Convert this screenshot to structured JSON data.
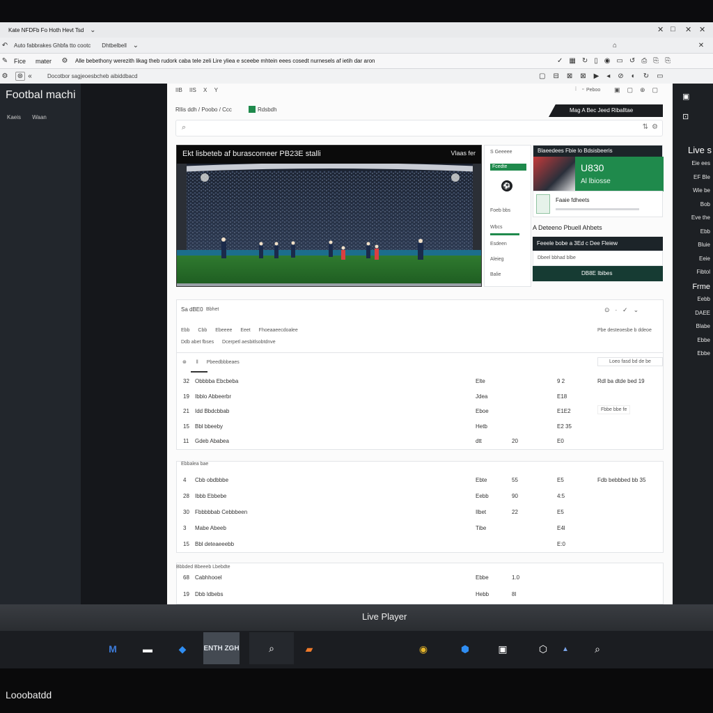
{
  "browser": {
    "tab_title": "Kate NFDFb Fo Hoth Hevt Tsd",
    "row2_tab1": "Auto fabbrakes Ghbfa tto cootc",
    "row2_tab2": "Dhtbelbell",
    "addr_label1": "Fice",
    "addr_label2": "mater",
    "address": "Alle bebethony werezith likag theb rudork caba tele zeli Lire yliea e sceebe mhtein eees cosedt nurnesels af ietih dar aron",
    "bookmark": "Docotbor sagjeoesbcheb aibiddbacd",
    "window_btns": [
      "✕",
      "□",
      "✕",
      "✕"
    ]
  },
  "left": {
    "title": "Footbal machi",
    "sub1": "Kaeis",
    "sub2": "Waan"
  },
  "main": {
    "toolbar": [
      "IIB",
      "IIS",
      "X",
      "Y"
    ],
    "toolbar_right": "Peboo",
    "breadcrumb": "Rllis ddh / Poobo / Ccc",
    "breadcrumb_tag": "Rdsbdh",
    "promo": "Mag A Bec Jeed Riballtae",
    "video_title": "Ekt lisbeteb af burascomeer PB23E stalli",
    "video_tag": "Vlaas fer",
    "side_title": "S Geeeee",
    "side_badge": "Fcedte",
    "side_l1": "Foeb bbs",
    "side_l2": "Wbcs",
    "side_l3": "Esdeen",
    "side_l4": "Aleieg",
    "side_l5": "Balie",
    "card_header": "Blaeedees Fbie lo Bdsisbeeris",
    "score": "U830",
    "score_sub": "Al lbiosse",
    "news1": "Faaie fdheets",
    "news2": "A Deteeno Pbuell Ahbets",
    "dark_card": "Feeele bobe a 3Ed c Dee Fleiew",
    "dark_card_sub": "Dbeel bbhad blbe",
    "dark_btn": "DB8E Ibibes"
  },
  "stats": {
    "header": "Sa dBE0",
    "header_sub": "Bbhet",
    "tabs": [
      "Ebb",
      "Cbb",
      "Ebeeee",
      "Eeet",
      "Fhoeaaeecdoalee"
    ],
    "sub_tabs": [
      "Ddb abet fbses",
      "Dcerpetl aesbitlsobtdnve"
    ],
    "filter": "Pbeedbbbeaes",
    "filter_right": "Loeo fasd bd de be",
    "side_note1": "Pbe desteoesbe b ddeoe",
    "side_note2": "Fbbe bbe fe",
    "rows1": [
      {
        "n": "32",
        "name": "Obbbba Ebcbeba",
        "pos": "Elte",
        "a": "",
        "b": "9 2",
        "side": "Rdl ba dtde bed 19"
      },
      {
        "n": "19",
        "name": "Ibblo Abbeerbr",
        "pos": "Jdea",
        "a": "",
        "b": "E18",
        "side": ""
      },
      {
        "n": "21",
        "name": "Idd Bbdcbbab",
        "pos": "Eboe",
        "a": "",
        "b": "E1E2",
        "side": ""
      },
      {
        "n": "15",
        "name": "Bbl bbeeby",
        "pos": "Hetb",
        "a": "",
        "b": "E2 35",
        "side": ""
      },
      {
        "n": "11",
        "name": "Gdeb Ababea",
        "pos": "dtt",
        "a": "20",
        "b": "E0",
        "side": ""
      }
    ],
    "group2": "Ebbalea bae",
    "rows2": [
      {
        "n": "4",
        "name": "Cbb obdbbbe",
        "pos": "Ebte",
        "a": "55",
        "b": "E5",
        "side": "Fdb bebbbed bb 35"
      },
      {
        "n": "28",
        "name": "Ibbb Ebbebe",
        "pos": "Eebb",
        "a": "90",
        "b": "4:5",
        "side": ""
      },
      {
        "n": "30",
        "name": "Fbbbbbab Cebbbeen",
        "pos": "Ilbet",
        "a": "22",
        "b": "E5",
        "side": ""
      },
      {
        "n": "3",
        "name": "Mabe Abeeb",
        "pos": "Tibe",
        "a": "",
        "b": "E4l",
        "side": ""
      },
      {
        "n": "15",
        "name": "Bbl deteaeeebb",
        "pos": "",
        "a": "",
        "b": "E:0",
        "side": ""
      }
    ],
    "group3": "Bbbded Bbeeeb Lbebdte",
    "rows3": [
      {
        "n": "68",
        "name": "Cabhhooel",
        "pos": "Ebbe",
        "a": "1.0"
      },
      {
        "n": "19",
        "name": "Dbb ldbebs",
        "pos": "Hebb",
        "a": "8l"
      }
    ]
  },
  "right": {
    "title": "Live s",
    "items": [
      "Eie ees",
      "EF Ble",
      "Wie be",
      "Bob",
      "Eve the",
      "Ebb",
      "Bluie",
      "Eeie",
      "Fibtol",
      "Frme",
      "Eebb",
      "DAEE",
      "Blabe",
      "Ebbe",
      "Ebbe"
    ]
  },
  "player": {
    "label": "Live Player"
  },
  "taskbar": {
    "icons": [
      "M",
      "folder",
      "shield",
      "ENTH ZGH",
      "search",
      "office",
      "chrome",
      "tile",
      "mail",
      "cloud",
      "arrow",
      "search2"
    ]
  },
  "footer": {
    "text": "Looobatdd"
  }
}
